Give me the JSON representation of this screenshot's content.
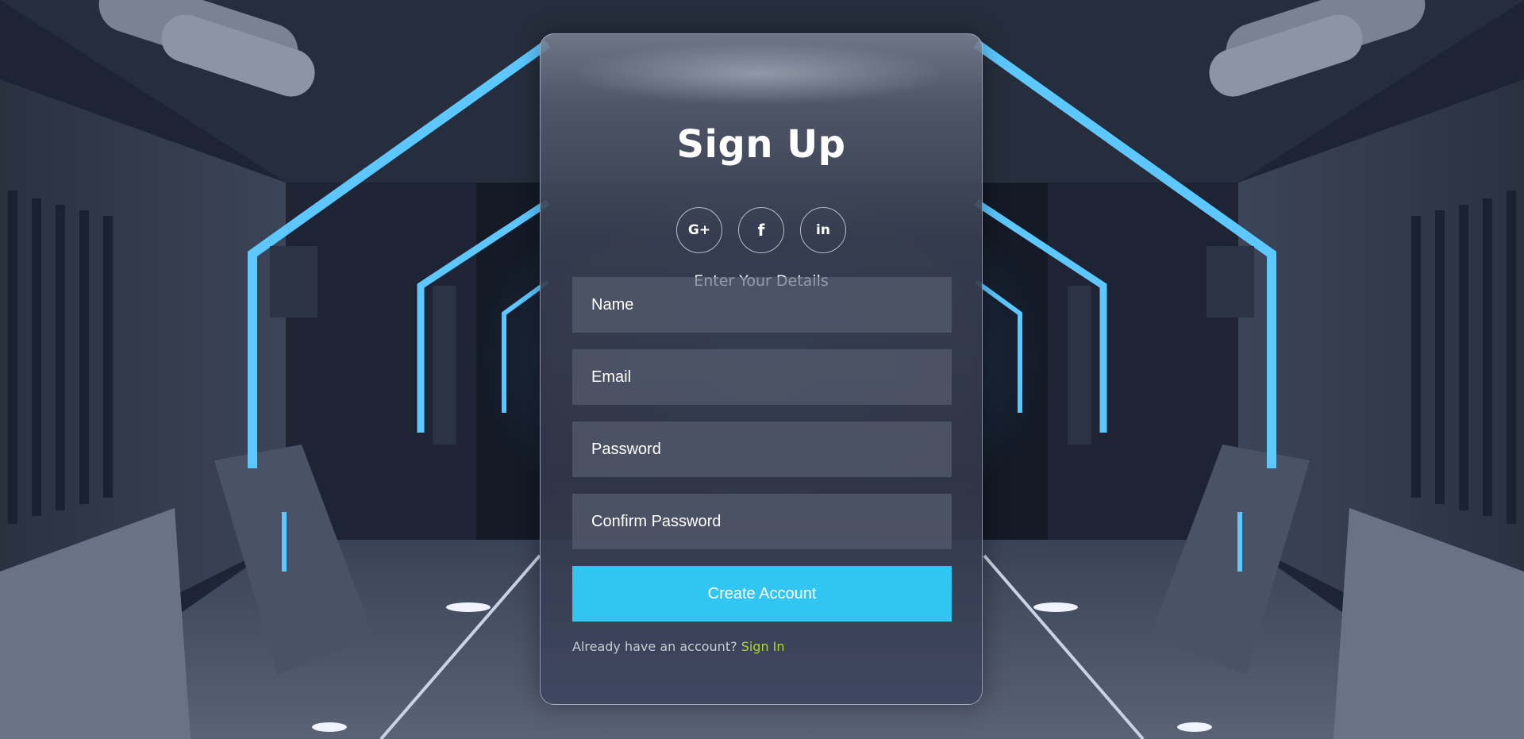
{
  "page": {
    "title": "Sign Up",
    "subtitle": "Enter Your Details"
  },
  "social": [
    {
      "name": "google-plus",
      "glyph": "G+"
    },
    {
      "name": "facebook",
      "glyph": "f"
    },
    {
      "name": "linkedin",
      "glyph": "in"
    }
  ],
  "form": {
    "name_placeholder": "Name",
    "email_placeholder": "Email",
    "password_placeholder": "Password",
    "confirm_placeholder": "Confirm Password",
    "submit_label": "Create Account"
  },
  "footer": {
    "prompt": "Already have an account?",
    "link": "Sign In"
  },
  "colors": {
    "accent": "#31c6f2",
    "link": "#a9d43a",
    "neon": "#5cc8ff"
  }
}
